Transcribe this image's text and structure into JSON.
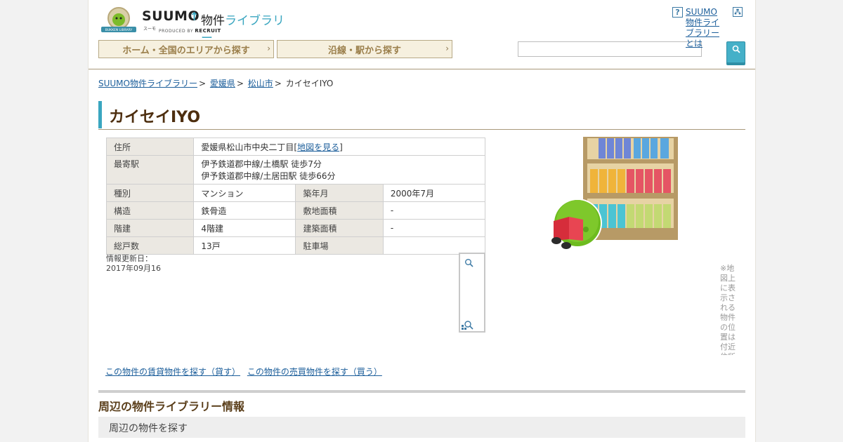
{
  "header": {
    "logo_suumo": "SUUMO",
    "logo_library_prefix": "物件",
    "logo_library_accent": "ライブラリー",
    "logo_suumo_reading": "スーモ",
    "logo_produced_by": "PRODUCED BY",
    "logo_recruit": "RECRUIT",
    "badge_text": "BUKKEN LIBRARY",
    "nav_home": "ホーム・全国のエリアから探す",
    "nav_line": "沿線・駅から探す",
    "search_placeholder": "",
    "help_label": "SUUMO物件ライブラリーとは"
  },
  "breadcrumb": {
    "root": "SUUMO物件ライブラリー",
    "level2": "愛媛県",
    "level3": "松山市",
    "current": "カイセイIYO"
  },
  "title": "カイセイIYO",
  "table": {
    "address_label": "住所",
    "address_value": "愛媛県松山市中央二丁目",
    "map_link": "地図を見る",
    "station_label": "最寄駅",
    "station_line1": "伊予鉄道郡中線/土橋駅 徒歩7分",
    "station_line2": "伊予鉄道郡中線/土居田駅 徒歩66分",
    "rows": [
      {
        "l1": "種別",
        "v1": "マンション",
        "l2": "築年月",
        "v2": "2000年7月"
      },
      {
        "l1": "構造",
        "v1": "鉄骨造",
        "l2": "敷地面積",
        "v2": "-"
      },
      {
        "l1": "階建",
        "v1": "4階建",
        "l2": "建築面積",
        "v2": "-"
      },
      {
        "l1": "総戸数",
        "v1": "13戸",
        "l2": "駐車場",
        "v2": ""
      }
    ]
  },
  "updated_label": "情報更新日：",
  "updated_date": "2017年09月16",
  "side_note": "※地図上に表示される物件の位置は付近住所に所在するものであり実際の物件の所在地とは異なる場合があります",
  "links": {
    "link1": "この物件の賃貸物件を探す（貸す）",
    "link2": "この物件の売買物件を探す（買う）"
  },
  "section": {
    "title": "周辺の物件ライブラリー情報",
    "subtitle": "周辺の物件を探す"
  },
  "colors": {
    "accent": "#3aa6c0",
    "link": "#1d5f9b",
    "title": "#4d2e0f",
    "nav_bg": "#f6f0df"
  }
}
